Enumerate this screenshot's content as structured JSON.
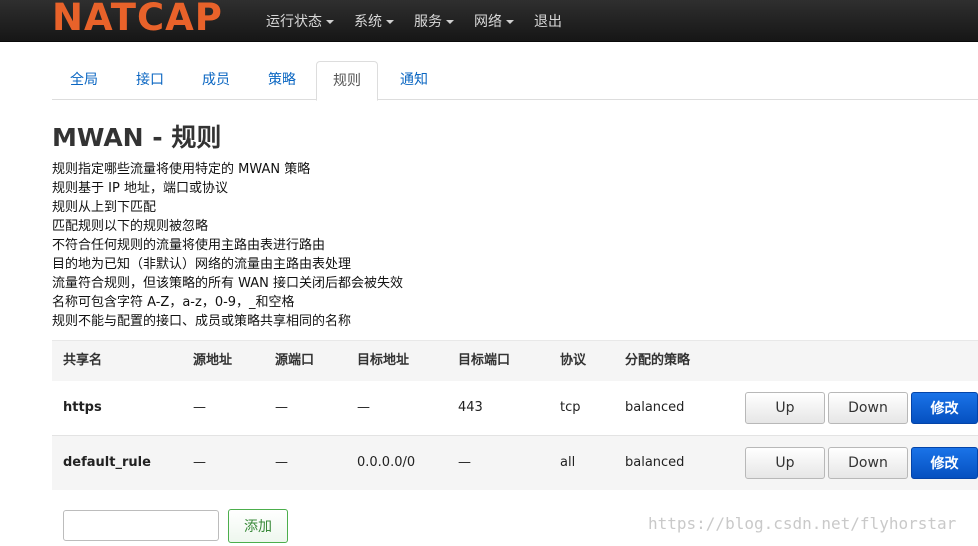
{
  "brand": {
    "logo_text": "NATCAP",
    "color": "#e8622a"
  },
  "nav": {
    "items": [
      {
        "label": "运行状态"
      },
      {
        "label": "系统"
      },
      {
        "label": "服务"
      },
      {
        "label": "网络"
      },
      {
        "label": "退出"
      }
    ]
  },
  "tabs": [
    {
      "label": "全局"
    },
    {
      "label": "接口"
    },
    {
      "label": "成员"
    },
    {
      "label": "策略"
    },
    {
      "label": "规则",
      "active": true
    },
    {
      "label": "通知"
    }
  ],
  "page": {
    "title": "MWAN - 规则",
    "description": [
      "规则指定哪些流量将使用特定的 MWAN 策略",
      "规则基于 IP 地址，端口或协议",
      "规则从上到下匹配",
      "匹配规则以下的规则被忽略",
      "不符合任何规则的流量将使用主路由表进行路由",
      "目的地为已知（非默认）网络的流量由主路由表处理",
      "流量符合规则，但该策略的所有 WAN 接口关闭后都会被失效",
      "名称可包含字符 A-Z，a-z，0-9，_和空格",
      "规则不能与配置的接口、成员或策略共享相同的名称"
    ]
  },
  "table": {
    "headers": [
      "共享名",
      "源地址",
      "源端口",
      "目标地址",
      "目标端口",
      "协议",
      "分配的策略"
    ],
    "rows": [
      {
        "name": "https",
        "src_addr": "—",
        "src_port": "—",
        "dst_addr": "—",
        "dst_port": "443",
        "proto": "tcp",
        "policy": "balanced"
      },
      {
        "name": "default_rule",
        "src_addr": "—",
        "src_port": "—",
        "dst_addr": "0.0.0.0/0",
        "dst_port": "—",
        "proto": "all",
        "policy": "balanced"
      }
    ],
    "buttons": {
      "up": "Up",
      "down": "Down",
      "edit": "修改"
    }
  },
  "add": {
    "input_value": "",
    "button_label": "添加"
  },
  "watermark": "https://blog.csdn.net/flyhorstar"
}
